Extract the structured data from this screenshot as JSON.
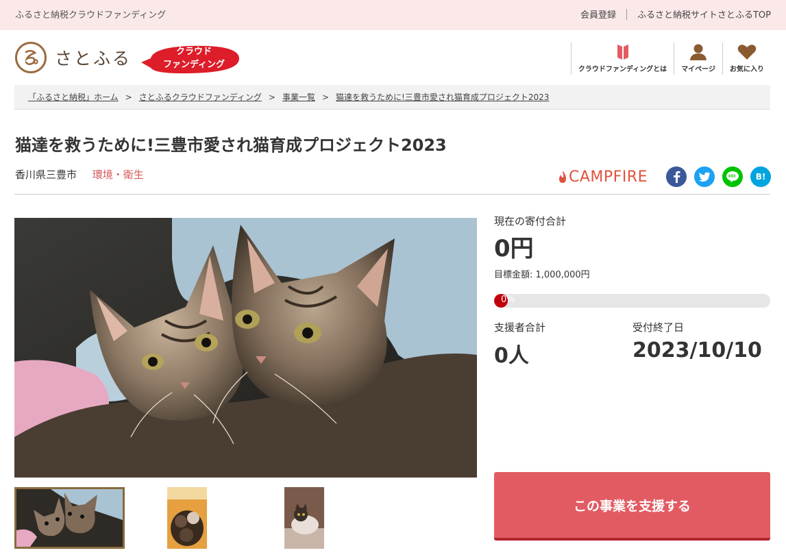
{
  "topbar": {
    "site_name": "ふるさと納税クラウドファンディング",
    "links": [
      "会員登録",
      "ふるさと納税サイトさとふるTOP"
    ]
  },
  "header": {
    "logo_text": "さとふる",
    "badge_line1": "クラウド",
    "badge_line2": "ファンディング",
    "nav": [
      {
        "label": "クラウドファンディングとは",
        "icon": "book-icon"
      },
      {
        "label": "マイページ",
        "icon": "user-icon"
      },
      {
        "label": "お気に入り",
        "icon": "heart-icon"
      }
    ]
  },
  "breadcrumb": [
    "「ふるさと納税」ホーム",
    "さとふるクラウドファンディング",
    "事業一覧",
    "猫達を救うために!三豊市愛され猫育成プロジェクト2023"
  ],
  "breadcrumb_separator": ">",
  "project": {
    "title": "猫達を救うために!三豊市愛され猫育成プロジェクト2023",
    "location": "香川県三豊市",
    "category": "環境・衛生"
  },
  "share": {
    "campfire": "CAMPFIRE",
    "hatena": "B!"
  },
  "funding": {
    "total_label": "現在の寄付合計",
    "total_value": "0円",
    "goal": "目標金額: 1,000,000円",
    "progress_text": "0%",
    "progress_fraction": 0,
    "supporters_label": "支援者合計",
    "supporters_value": "0人",
    "deadline_label": "受付終了日",
    "deadline_value": "2023/10/10"
  },
  "cta": {
    "support_label": "この事業を支援する"
  },
  "colors": {
    "topbar_bg": "#fbe9ea",
    "accent_red": "#e25b63",
    "badge_red": "#dd1d2a",
    "brand_brown": "#9b6b3f",
    "progress_red": "#c0000a"
  }
}
